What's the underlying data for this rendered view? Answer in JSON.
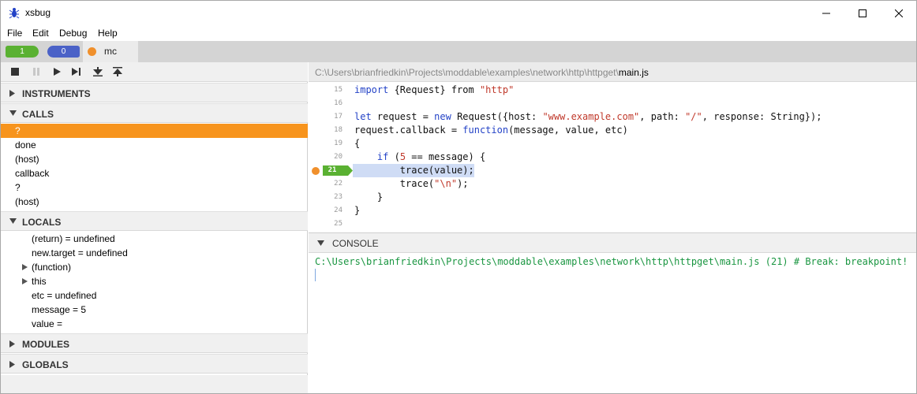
{
  "window": {
    "title": "xsbug"
  },
  "menu": [
    "File",
    "Edit",
    "Debug",
    "Help"
  ],
  "tabs": {
    "green_count": "1",
    "blue_count": "0",
    "active_label": "mc"
  },
  "toolbar": [
    "stop-icon",
    "pause-icon",
    "play-icon",
    "step-icon",
    "step-in-icon",
    "step-out-icon"
  ],
  "sections": {
    "instruments": "INSTRUMENTS",
    "calls": "CALLS",
    "locals": "LOCALS",
    "modules": "MODULES",
    "globals": "GLOBALS"
  },
  "calls": [
    "?",
    "done",
    "(host)",
    "callback",
    "?",
    "(host)"
  ],
  "locals": [
    {
      "text": "(return) = undefined",
      "expandable": false
    },
    {
      "text": "new.target = undefined",
      "expandable": false
    },
    {
      "text": "(function)",
      "expandable": true
    },
    {
      "text": "this",
      "expandable": true
    },
    {
      "text": "etc = undefined",
      "expandable": false
    },
    {
      "text": "message = 5",
      "expandable": false
    },
    {
      "text": "value =",
      "expandable": false
    }
  ],
  "path": {
    "prefix": "C:\\Users\\brianfriedkin\\Projects\\moddable\\examples\\network\\http\\httpget\\",
    "file": "main.js"
  },
  "code": {
    "line_numbers": [
      "15",
      "16",
      "17",
      "18",
      "19",
      "20",
      "21",
      "22",
      "23",
      "24",
      "25"
    ],
    "current_line": "21",
    "l15_kw": "import",
    "l15_mid": " {Request} from ",
    "l15_str": "\"http\"",
    "l17_kw": "let",
    "l17_a": " request = ",
    "l17_kw2": "new",
    "l17_b": " Request({host: ",
    "l17_str1": "\"www.example.com\"",
    "l17_c": ", path: ",
    "l17_str2": "\"/\"",
    "l17_d": ", response: String});",
    "l18_a": "request.callback = ",
    "l18_kw": "function",
    "l18_b": "(message, value, etc)",
    "l19": "{",
    "l20_indent": "    ",
    "l20_kw": "if",
    "l20_a": " (",
    "l20_num": "5",
    "l20_b": " == message) {",
    "l21": "        trace(value);",
    "l22_a": "        trace(",
    "l22_str": "\"\\n\"",
    "l22_b": ");",
    "l23": "    }",
    "l24": "}"
  },
  "console": {
    "label": "CONSOLE",
    "line": "C:\\Users\\brianfriedkin\\Projects\\moddable\\examples\\network\\http\\httpget\\main.js (21) # Break: breakpoint!"
  },
  "colors": {
    "selected_call": "#f7941d",
    "breakpoint": "#f0902c",
    "current_line_flag": "#5ab132",
    "console_text": "#1a9641"
  }
}
